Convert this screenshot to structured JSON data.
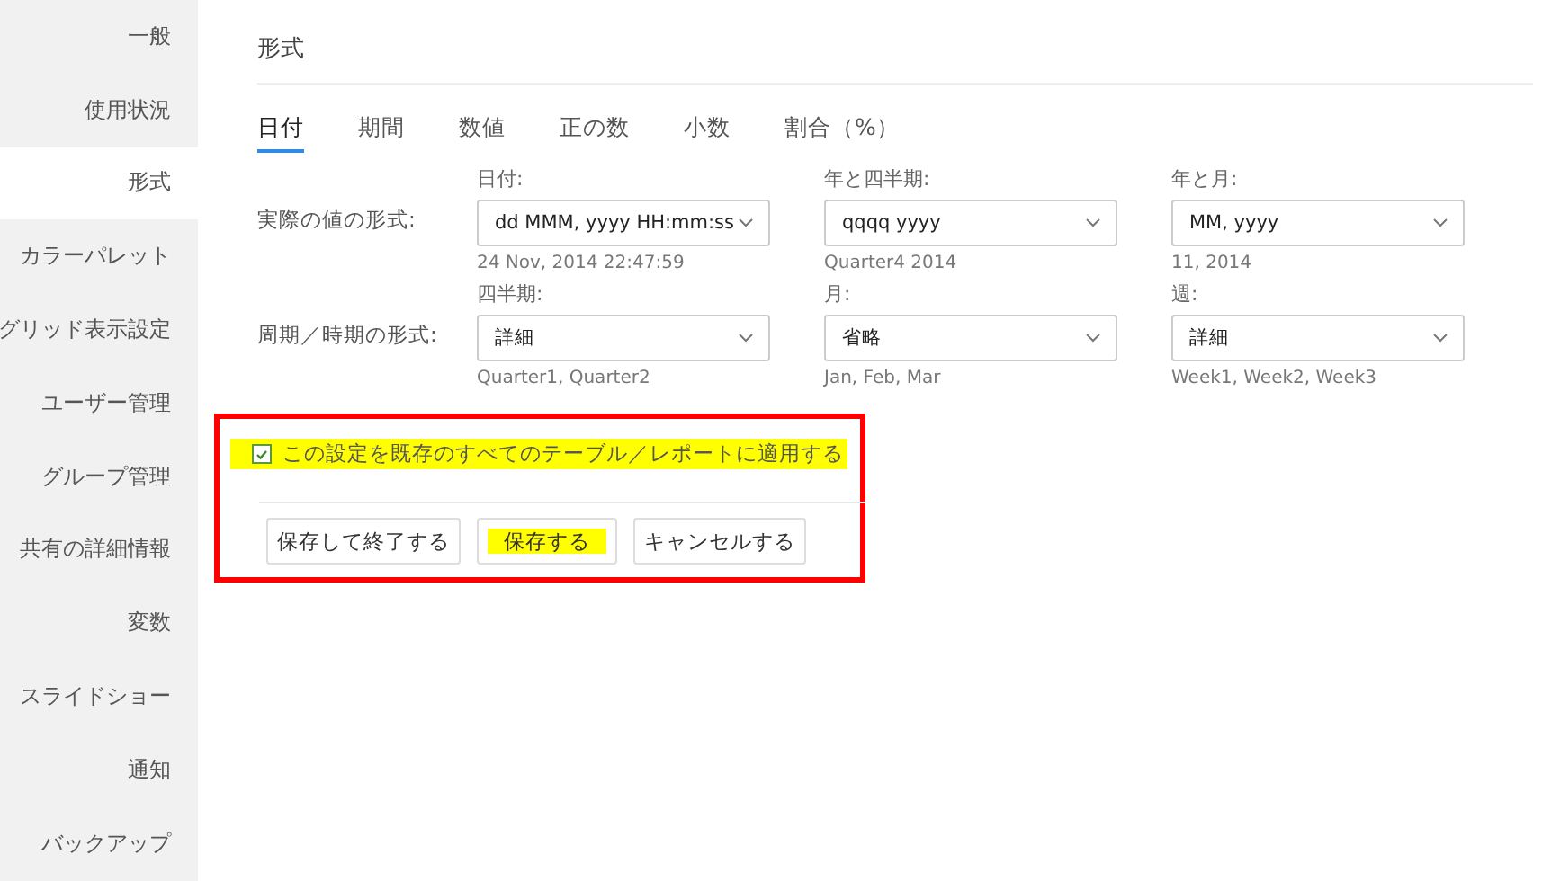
{
  "sidebar": {
    "items": [
      {
        "label": "一般",
        "selected": false
      },
      {
        "label": "使用状況",
        "selected": false
      },
      {
        "label": "形式",
        "selected": true
      },
      {
        "label": "カラーパレット",
        "selected": false
      },
      {
        "label": "グリッド表示設定",
        "selected": false
      },
      {
        "label": "ユーザー管理",
        "selected": false
      },
      {
        "label": "グループ管理",
        "selected": false
      },
      {
        "label": "共有の詳細情報",
        "selected": false
      },
      {
        "label": "変数",
        "selected": false
      },
      {
        "label": "スライドショー",
        "selected": false
      },
      {
        "label": "通知",
        "selected": false
      },
      {
        "label": "バックアップ",
        "selected": false
      }
    ]
  },
  "title": "形式",
  "tabs": [
    {
      "label": "日付",
      "selected": true
    },
    {
      "label": "期間",
      "selected": false
    },
    {
      "label": "数値",
      "selected": false
    },
    {
      "label": "正の数",
      "selected": false
    },
    {
      "label": "小数",
      "selected": false
    },
    {
      "label": "割合（%）",
      "selected": false
    }
  ],
  "form_rows": [
    {
      "label": "実際の値の形式:",
      "fields": [
        {
          "label": "日付:",
          "value": "dd MMM, yyyy HH:mm:ss",
          "hint": "24 Nov, 2014 22:47:59"
        },
        {
          "label": "年と四半期:",
          "value": "qqqq yyyy",
          "hint": "Quarter4 2014"
        },
        {
          "label": "年と月:",
          "value": "MM, yyyy",
          "hint": "11, 2014"
        }
      ]
    },
    {
      "label": "周期／時期の形式:",
      "fields": [
        {
          "label": "四半期:",
          "value": "詳細",
          "hint": "Quarter1, Quarter2"
        },
        {
          "label": "月:",
          "value": "省略",
          "hint": "Jan, Feb, Mar"
        },
        {
          "label": "週:",
          "value": "詳細",
          "hint": "Week1, Week2, Week3"
        }
      ]
    }
  ],
  "annotation_frame": true,
  "apply_all": {
    "label": "この設定を既存のすべてのテーブル／レポートに適用する",
    "checked": true,
    "highlighted": true
  },
  "buttons": [
    {
      "label": "保存して終了する",
      "highlighted": false
    },
    {
      "label": "保存する",
      "highlighted": true
    },
    {
      "label": "キャンセルする",
      "highlighted": false
    }
  ]
}
